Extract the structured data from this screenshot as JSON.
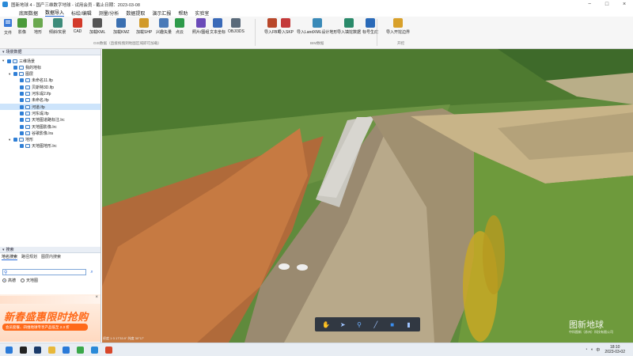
{
  "window": {
    "title": "图新地球 4 - 国产三维数字地球 - 试用会员 - 截止日期：2023-03-08"
  },
  "menu": [
    "底图数据",
    "数据导入",
    "标绘/编辑",
    "测量/分析",
    "数据提取",
    "演示汇报",
    "帮助",
    "实验室"
  ],
  "ribbon": {
    "file_label": "文件",
    "buttons": [
      {
        "label": "影像",
        "color": "#4a9a3a"
      },
      {
        "label": "地形",
        "color": "#6aa84f"
      },
      {
        "label": "倾斜/实景",
        "color": "#3d8b7a"
      },
      {
        "label": "CAD",
        "color": "#d33a2a"
      },
      {
        "label": "加载KML",
        "color": "#555555"
      },
      {
        "label": "加载KMZ",
        "color": "#3a6fb0"
      },
      {
        "label": "加载SHP",
        "color": "#d19a2a"
      },
      {
        "label": "兴趣矢量",
        "color": "#4a7ab8"
      },
      {
        "label": "点云",
        "color": "#2e9a4a"
      },
      {
        "label": "照片/图组",
        "color": "#6a4ab8"
      },
      {
        "label": "文本坐标",
        "color": "#3a6ab8"
      },
      {
        "label": "OBJ/3DS",
        "color": "#5a6a7a"
      },
      {
        "label": "导入FBX",
        "color": "#b8472a"
      },
      {
        "label": "导入SKP",
        "color": "#c43a3a"
      },
      {
        "label": "导入LandXML设计地形",
        "color": "#3a8ab8"
      },
      {
        "label": "导入填挖数据",
        "color": "#2a8a6a"
      },
      {
        "label": "标号生成",
        "color": "#2a6ab8"
      },
      {
        "label": "导入开挖边界",
        "color": "#d8a02a"
      }
    ],
    "groups": [
      "GIS数据（直接拖拽到地图区域即可加载）",
      "BIM数据",
      "开挖"
    ]
  },
  "scene_panel": {
    "header": "场景数据",
    "tree": [
      {
        "label": "三维场景",
        "level": 0,
        "expand": "▾",
        "sel": false
      },
      {
        "label": "我的地标",
        "level": 1,
        "expand": "",
        "sel": false
      },
      {
        "label": "图层",
        "level": 1,
        "expand": "▾",
        "sel": false
      },
      {
        "label": "未命名11.lfp",
        "level": 2,
        "expand": "",
        "sel": false
      },
      {
        "label": "贝斯特3D.lfp",
        "level": 2,
        "expand": "",
        "sel": false
      },
      {
        "label": "河东堤2.lfp",
        "level": 2,
        "expand": "",
        "sel": false
      },
      {
        "label": "未命名.lfp",
        "level": 2,
        "expand": "",
        "sel": false
      },
      {
        "label": "河道.lfp",
        "level": 2,
        "expand": "",
        "sel": true
      },
      {
        "label": "河东堤.lfp",
        "level": 2,
        "expand": "",
        "sel": false
      },
      {
        "label": "天地图道路标注.lrc",
        "level": 2,
        "expand": "",
        "sel": false
      },
      {
        "label": "天地图影像.lrc",
        "level": 2,
        "expand": "",
        "sel": false
      },
      {
        "label": "谷歌影像.lra",
        "level": 2,
        "expand": "",
        "sel": false
      },
      {
        "label": "地形",
        "level": 1,
        "expand": "▾",
        "sel": false
      },
      {
        "label": "天地图地形.lrc",
        "level": 2,
        "expand": "",
        "sel": false
      }
    ]
  },
  "search_panel": {
    "header": "搜索",
    "tabs": [
      "地名搜索",
      "路径规划",
      "图层内搜索"
    ],
    "placeholder": "",
    "radio1": "高德",
    "radio2": "天地图"
  },
  "ad": {
    "title": "新春盛惠限时抢购",
    "subtitle": "会员套餐、四维地球专享产品低至 2.3 折",
    "close": "×"
  },
  "viewport": {
    "watermark": "图新地球",
    "watermark_sub": "中科图新（苏州）科技有限公司",
    "scale_text": "经度 1·3 17'33.9\"  纬度 30°17'"
  },
  "map_tools": [
    "hand-icon",
    "pointer-icon",
    "pin-icon",
    "line-icon",
    "polygon-icon",
    "chart-icon"
  ],
  "taskbar": {
    "time": "18:10",
    "date": "2023-03-02",
    "lang": "中",
    "apps": [
      {
        "name": "windows-icon",
        "color": "#2a7ad8"
      },
      {
        "name": "terminal-icon",
        "color": "#222222"
      },
      {
        "name": "photoshop-icon",
        "color": "#1a3a6a"
      },
      {
        "name": "folder-icon",
        "color": "#e8b83a"
      },
      {
        "name": "vscode-icon",
        "color": "#2a7ad8"
      },
      {
        "name": "chrome-icon",
        "color": "#3aa84a"
      },
      {
        "name": "globe-icon",
        "color": "#2a8ad8"
      },
      {
        "name": "app-icon",
        "color": "#d8472a"
      }
    ]
  }
}
